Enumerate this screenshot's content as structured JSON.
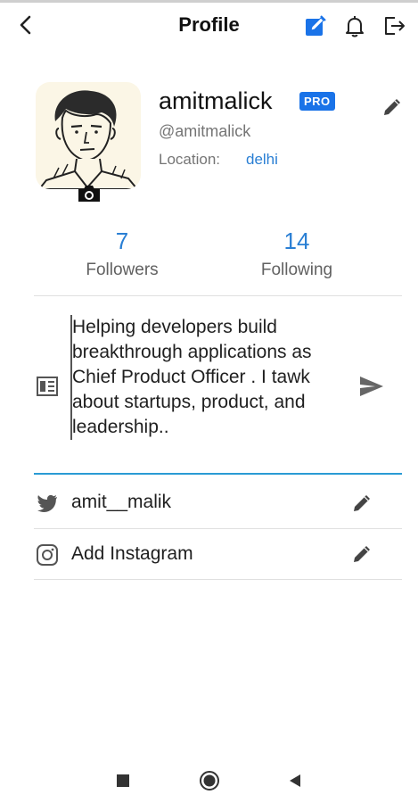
{
  "header": {
    "title": "Profile",
    "icons": [
      "back-arrow-icon",
      "edit-note-icon",
      "bell-icon",
      "logout-icon"
    ],
    "accent": "#1a73e8"
  },
  "profile": {
    "username": "amitmalick",
    "badge": "PRO",
    "handle": "@amitmalick",
    "location_label": "Location:",
    "location_value": "delhi"
  },
  "stats": {
    "followers_count": "7",
    "followers_label": "Followers",
    "following_count": "14",
    "following_label": "Following"
  },
  "bio": {
    "text": "Helping developers build breakthrough applications as Chief Product Officer . I tawk about startups, product, and leadership.."
  },
  "social": {
    "twitter": "amit__malik",
    "instagram": "Add Instagram"
  },
  "colors": {
    "link": "#2a7fd4",
    "underline": "#2a9bd4",
    "muted": "#757575"
  }
}
